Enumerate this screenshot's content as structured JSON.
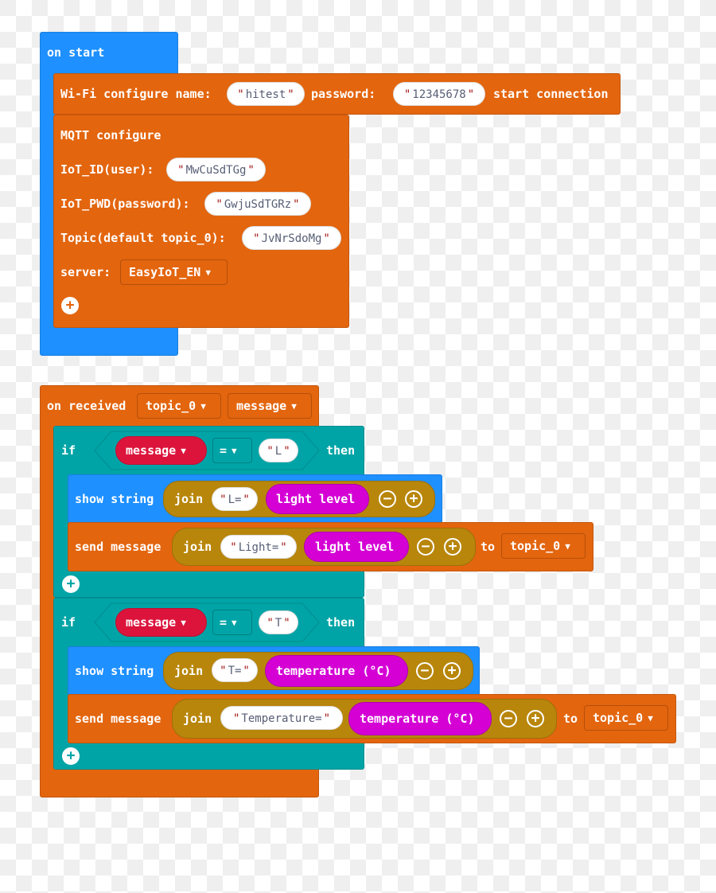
{
  "on_start": {
    "label": "on start",
    "wifi": {
      "label": "Wi-Fi configure name:",
      "name_value": "hitest",
      "password_label": "password:",
      "password_value": "12345678",
      "suffix": "start connection"
    },
    "mqtt": {
      "label": "MQTT configure",
      "iot_id_label": "IoT_ID(user):",
      "iot_id_value": "MwCuSdTGg",
      "iot_pwd_label": "IoT_PWD(password):",
      "iot_pwd_value": "GwjuSdTGRz",
      "topic_label": "Topic(default topic_0):",
      "topic_value": "JvNrSdoMg",
      "server_label": "server:",
      "server_value": "EasyIoT_EN",
      "add_icon": "plus-circle-icon"
    }
  },
  "on_received": {
    "label": "on received",
    "topic_dropdown": "topic_0",
    "message_dropdown": "message",
    "if_blocks": [
      {
        "if_label": "if",
        "var": "message",
        "op": "=",
        "value": "L",
        "then_label": "then",
        "show_string": {
          "label": "show string",
          "join": "join",
          "text": "L=",
          "sensor": "light level"
        },
        "send_message": {
          "label": "send message",
          "join": "join",
          "text": "Light=",
          "sensor": "light level",
          "to_label": "to",
          "topic": "topic_0"
        }
      },
      {
        "if_label": "if",
        "var": "message",
        "op": "=",
        "value": "T",
        "then_label": "then",
        "show_string": {
          "label": "show string",
          "join": "join",
          "text": "T=",
          "sensor": "temperature (°C)"
        },
        "send_message": {
          "label": "send message",
          "join": "join",
          "text": "Temperature=",
          "sensor": "temperature (°C)",
          "to_label": "to",
          "topic": "topic_0"
        }
      }
    ]
  },
  "colors": {
    "events_blue": "#1e90ff",
    "iot_orange": "#e3650e",
    "logic_teal": "#00a4a6",
    "text_gold": "#b8860b",
    "input_magenta": "#d400d4",
    "variable_red": "#dc143c"
  }
}
